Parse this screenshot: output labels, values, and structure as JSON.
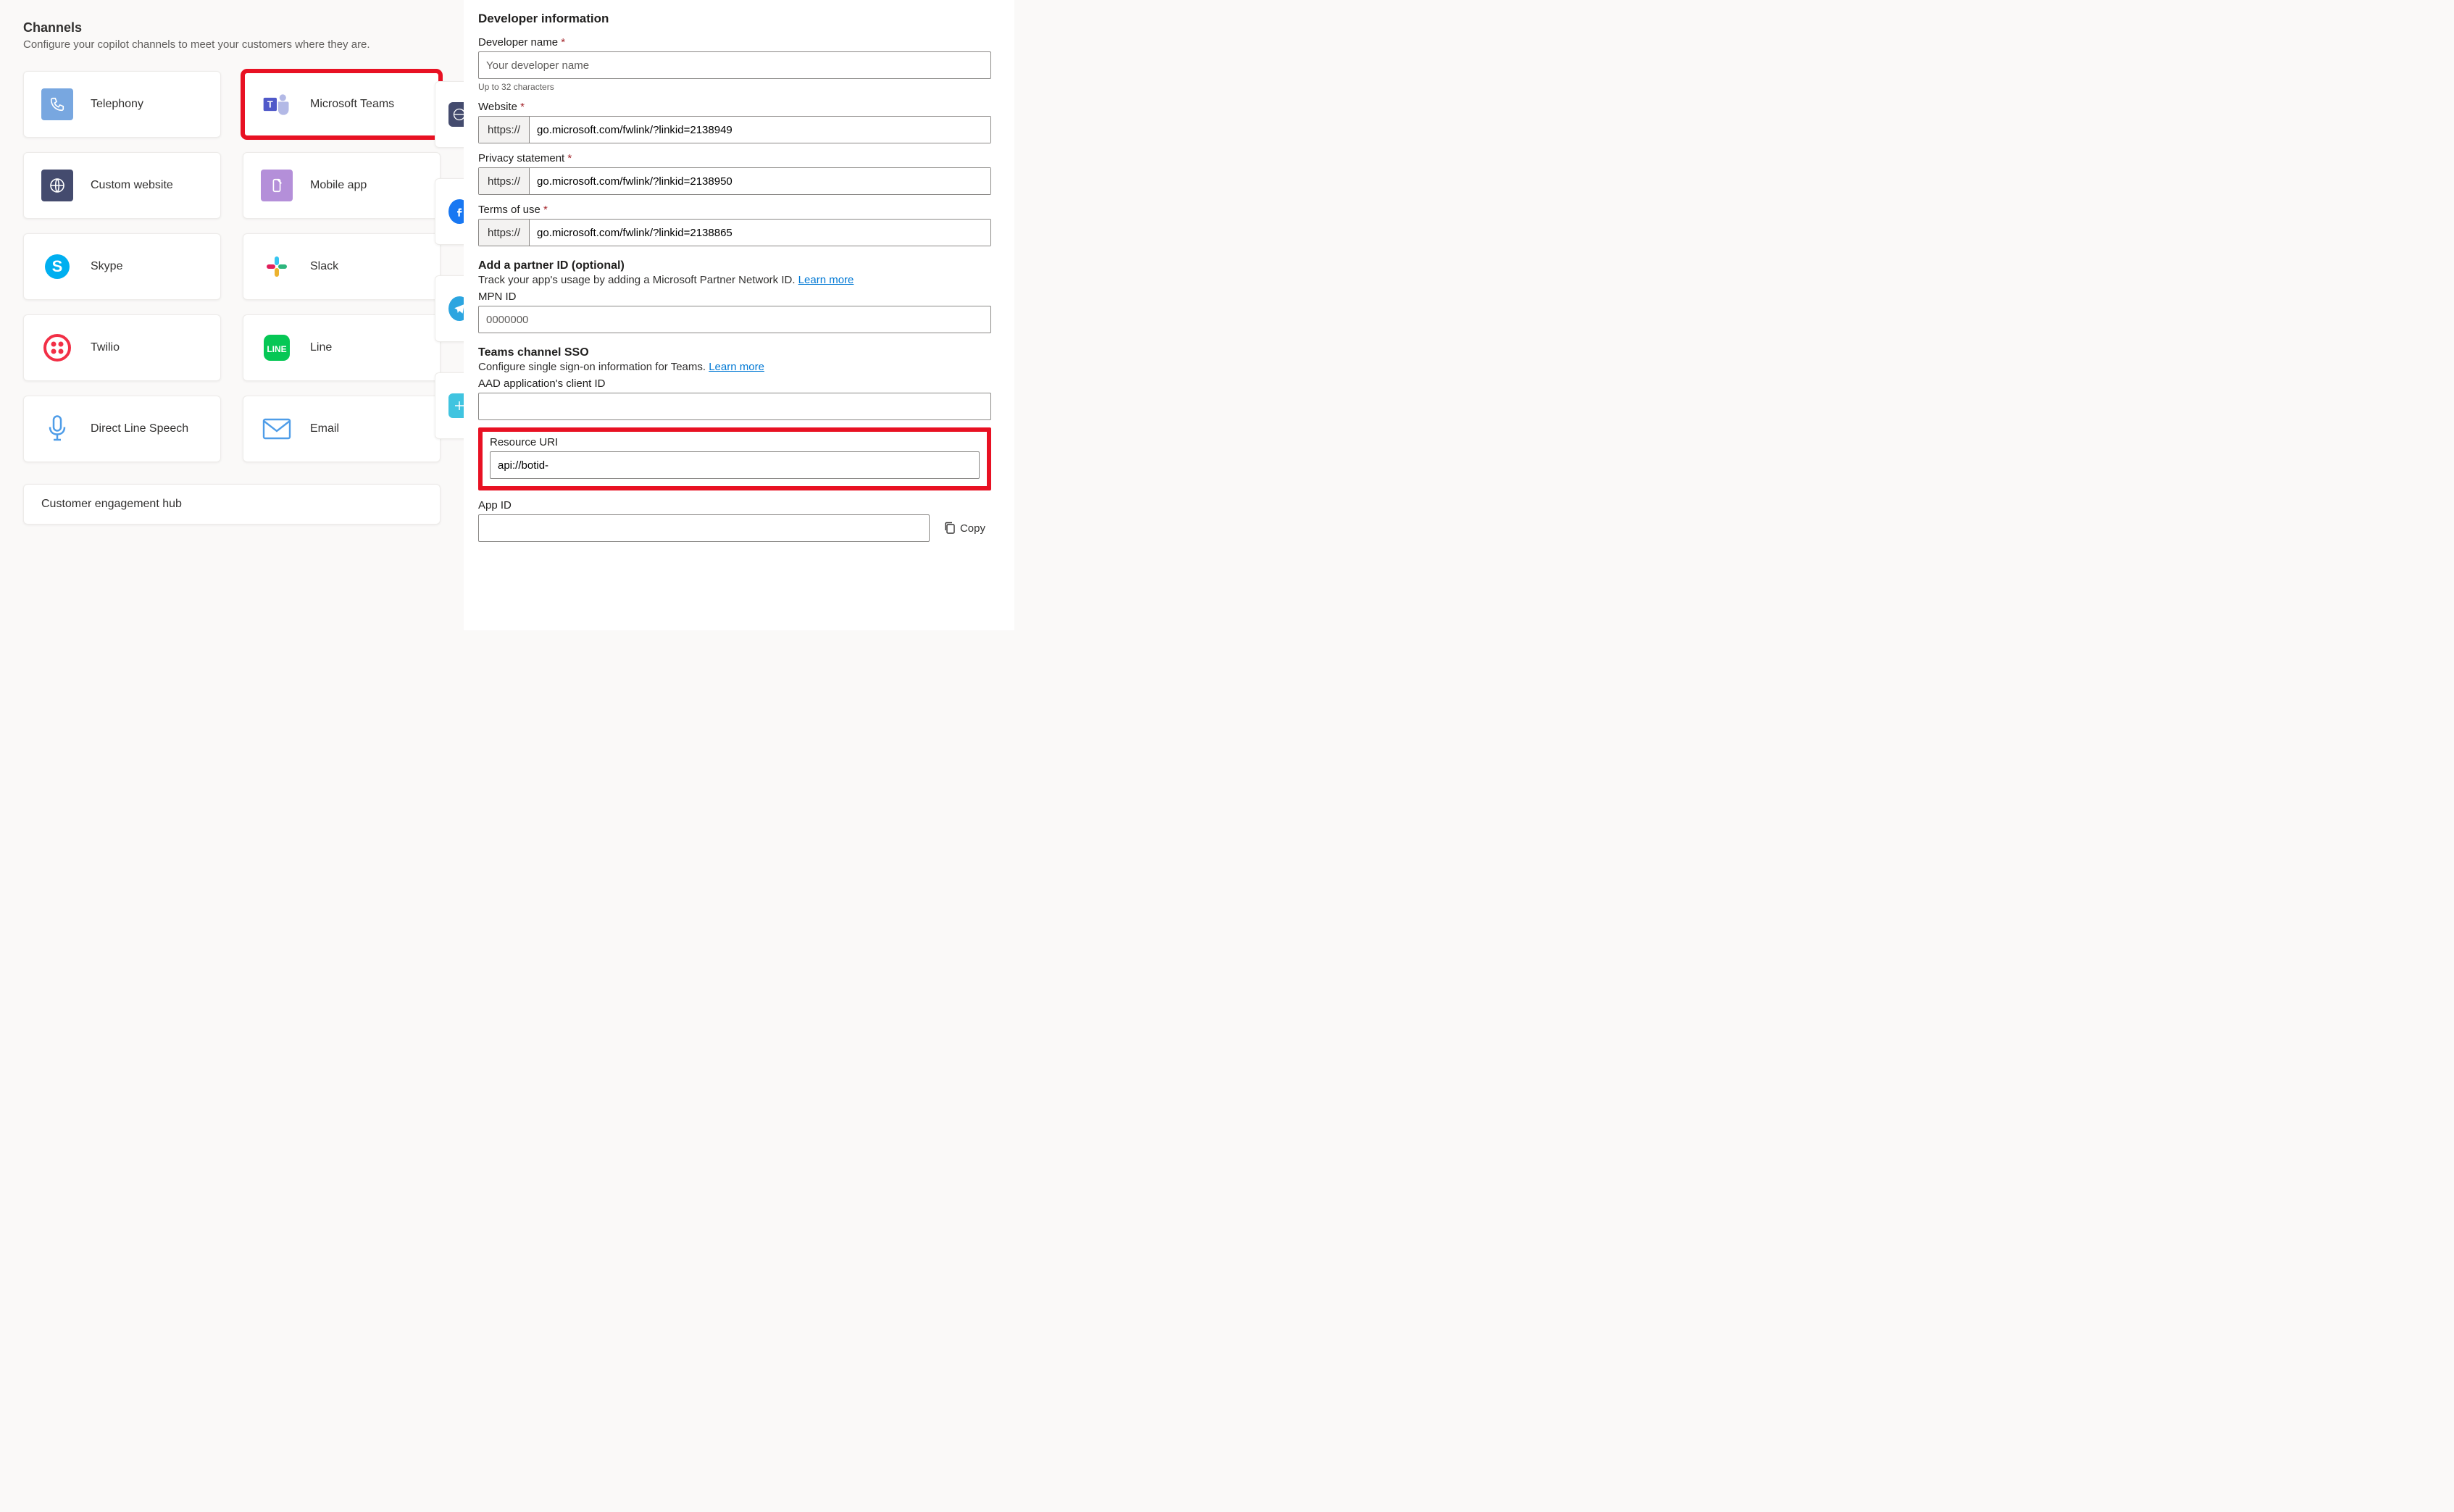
{
  "channels": {
    "title": "Channels",
    "description": "Configure your copilot channels to meet your customers where they are.",
    "items": [
      {
        "label": "Telephony",
        "icon": "phone-icon"
      },
      {
        "label": "Microsoft Teams",
        "icon": "teams-icon",
        "highlighted": true
      },
      {
        "label": "Custom website",
        "icon": "globe-icon"
      },
      {
        "label": "Mobile app",
        "icon": "mobile-icon"
      },
      {
        "label": "Skype",
        "icon": "skype-icon"
      },
      {
        "label": "Slack",
        "icon": "slack-icon"
      },
      {
        "label": "Twilio",
        "icon": "twilio-icon"
      },
      {
        "label": "Line",
        "icon": "line-icon"
      },
      {
        "label": "Direct Line Speech",
        "icon": "mic-icon"
      },
      {
        "label": "Email",
        "icon": "email-icon"
      }
    ]
  },
  "hub": {
    "title": "Customer engagement hub"
  },
  "form": {
    "heading": "Developer information",
    "devName": {
      "label": "Developer name",
      "placeholder": "Your developer name",
      "help": "Up to 32 characters"
    },
    "website": {
      "label": "Website",
      "prefix": "https://",
      "value": "go.microsoft.com/fwlink/?linkid=2138949"
    },
    "privacy": {
      "label": "Privacy statement",
      "prefix": "https://",
      "value": "go.microsoft.com/fwlink/?linkid=2138950"
    },
    "terms": {
      "label": "Terms of use",
      "prefix": "https://",
      "value": "go.microsoft.com/fwlink/?linkid=2138865"
    },
    "partner": {
      "heading": "Add a partner ID (optional)",
      "desc_pre": "Track your app's usage by adding a Microsoft Partner Network ID. ",
      "learn": "Learn more",
      "mpnLabel": "MPN ID",
      "mpnPlaceholder": "0000000"
    },
    "sso": {
      "heading": "Teams channel SSO",
      "desc_pre": "Configure single sign-on information for Teams. ",
      "learn": "Learn more",
      "aadLabel": "AAD application's client ID",
      "resLabel": "Resource URI",
      "resValue": "api://botid-",
      "appIdLabel": "App ID",
      "copy": "Copy"
    }
  }
}
